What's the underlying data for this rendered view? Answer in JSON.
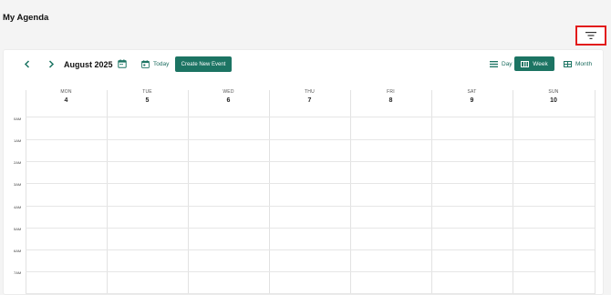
{
  "page": {
    "title": "My Agenda"
  },
  "filter": {
    "icon": "filter-lines-icon"
  },
  "toolbar": {
    "prev_icon": "chevron-left-icon",
    "next_icon": "chevron-right-icon",
    "month_label": "August 2025",
    "calendar_icon": "calendar-icon",
    "today_label": "Today",
    "create_label": "Create New Event",
    "views": [
      {
        "label": "Day",
        "icon": "day-view-icon",
        "active": false
      },
      {
        "label": "Week",
        "icon": "week-view-icon",
        "active": true
      },
      {
        "label": "Month",
        "icon": "month-view-icon",
        "active": false
      }
    ]
  },
  "week": {
    "days": [
      {
        "name": "MON",
        "num": "4"
      },
      {
        "name": "TUE",
        "num": "5"
      },
      {
        "name": "WED",
        "num": "6"
      },
      {
        "name": "THU",
        "num": "7"
      },
      {
        "name": "FRI",
        "num": "8"
      },
      {
        "name": "SAT",
        "num": "9"
      },
      {
        "name": "SUN",
        "num": "10"
      }
    ],
    "hours": [
      "0AM",
      "1AM",
      "2AM",
      "3AM",
      "4AM",
      "5AM",
      "6AM",
      "7AM"
    ]
  },
  "colors": {
    "accent": "#1c7463",
    "highlight": "#e21b1b"
  }
}
